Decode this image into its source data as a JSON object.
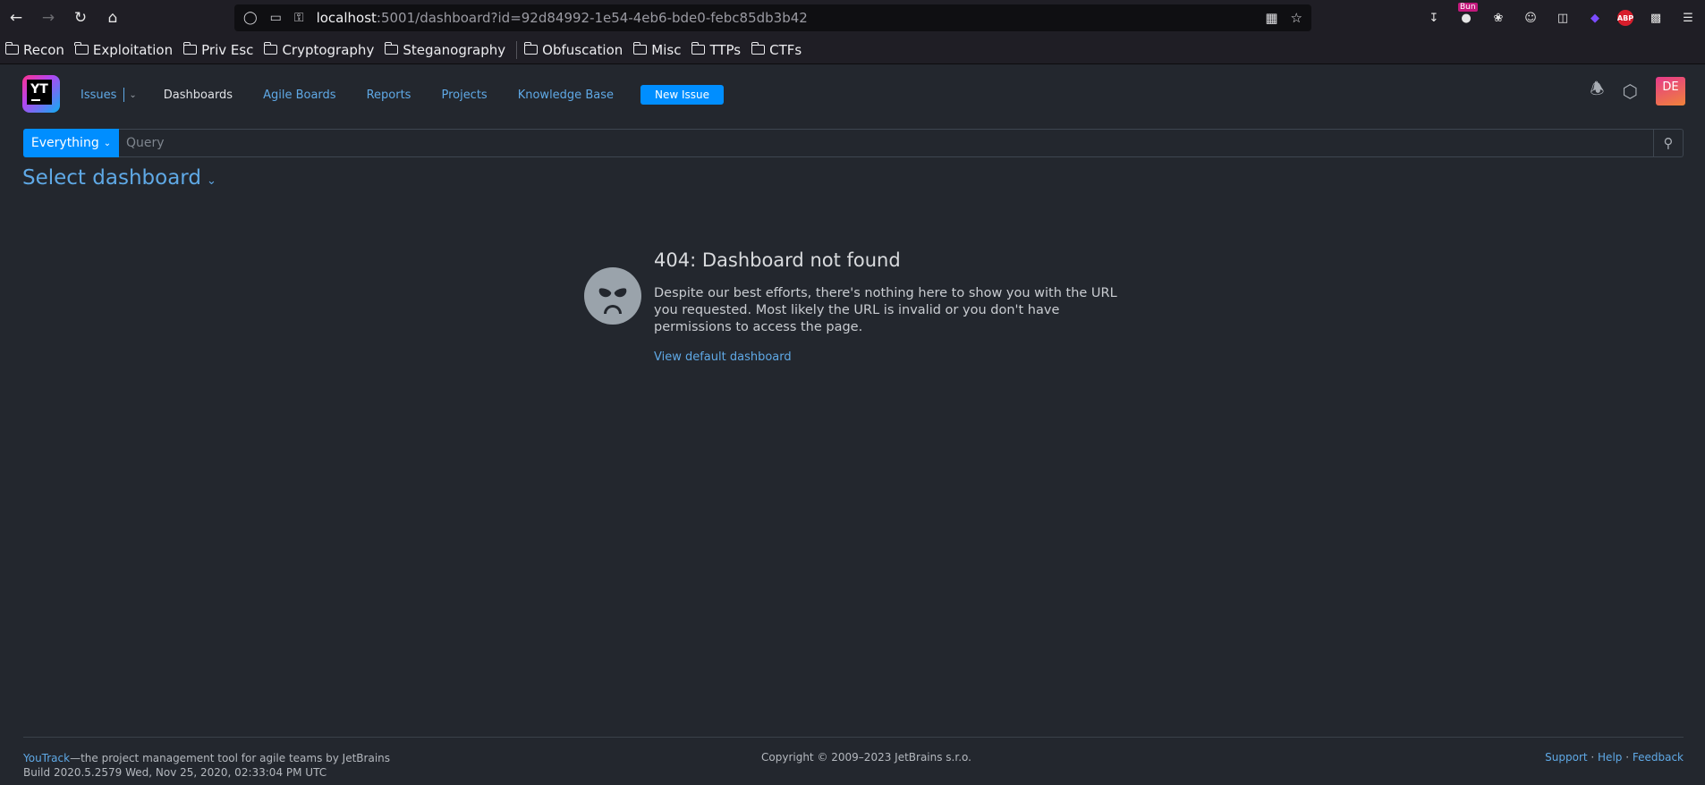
{
  "browser": {
    "url_host": "localhost",
    "url_path": ":5001/dashboard?id=92d84992-1e54-4eb6-bde0-febc85db3b42",
    "ext_badge": "Bun",
    "abp_label": "ABP",
    "bookmarks": [
      "Recon",
      "Exploitation",
      "Priv Esc",
      "Cryptography",
      "Steganography",
      "Obfuscation",
      "Misc",
      "TTPs",
      "CTFs"
    ]
  },
  "header": {
    "logo_text": "YT",
    "issues": "Issues",
    "nav": [
      "Dashboards",
      "Agile Boards",
      "Reports",
      "Projects",
      "Knowledge Base"
    ],
    "new_issue": "New Issue",
    "avatar": "DE"
  },
  "search": {
    "context": "Everything",
    "placeholder": "Query"
  },
  "dashboard": {
    "select_label": "Select dashboard"
  },
  "error": {
    "title": "404: Dashboard not found",
    "message": "Despite our best efforts, there's nothing here to show you with the URL you requested. Most likely the URL is invalid or you don't have permissions to access the page.",
    "link": "View default dashboard"
  },
  "footer": {
    "product": "YouTrack",
    "tagline": "—the project management tool for agile teams by JetBrains",
    "build": "Build 2020.5.2579 Wed, Nov 25, 2020, 02:33:04 PM UTC",
    "copyright": "Copyright © 2009–2023 JetBrains s.r.o.",
    "support": "Support",
    "help": "Help",
    "feedback": "Feedback"
  },
  "colors": {
    "accent": "#008eff",
    "link": "#5fa9e6",
    "background": "#23272e"
  }
}
